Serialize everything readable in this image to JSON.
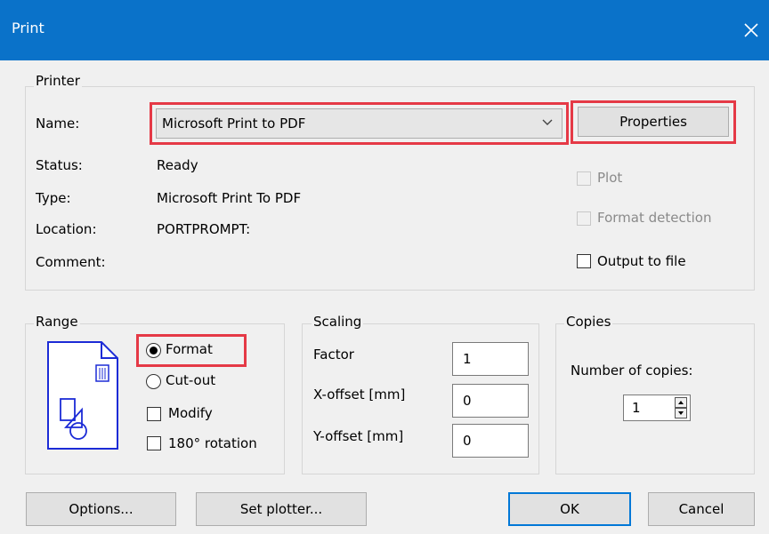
{
  "window": {
    "title": "Print"
  },
  "printer": {
    "legend": "Printer",
    "name_label": "Name:",
    "name_value": "Microsoft Print to PDF",
    "properties_label": "Properties",
    "status_label": "Status:",
    "status_value": "Ready",
    "type_label": "Type:",
    "type_value": "Microsoft Print To PDF",
    "location_label": "Location:",
    "location_value": "PORTPROMPT:",
    "comment_label": "Comment:",
    "comment_value": "",
    "plot_label": "Plot",
    "format_detection_label": "Format detection",
    "output_to_file_label": "Output to file"
  },
  "range": {
    "legend": "Range",
    "format_label": "Format",
    "format_selected": true,
    "cutout_label": "Cut-out",
    "modify_label": "Modify",
    "rotation_label": "180° rotation"
  },
  "scaling": {
    "legend": "Scaling",
    "factor_label": "Factor",
    "factor_value": "1",
    "xoffset_label": "X-offset [mm]",
    "xoffset_value": "0",
    "yoffset_label": "Y-offset [mm]",
    "yoffset_value": "0"
  },
  "copies": {
    "legend": "Copies",
    "number_label": "Number of copies:",
    "number_value": "1"
  },
  "buttons": {
    "options": "Options...",
    "set_plotter": "Set plotter...",
    "ok": "OK",
    "cancel": "Cancel"
  },
  "colors": {
    "titlebar": "#0a72c9",
    "highlight": "#e53946",
    "default_button_border": "#0078d7"
  }
}
